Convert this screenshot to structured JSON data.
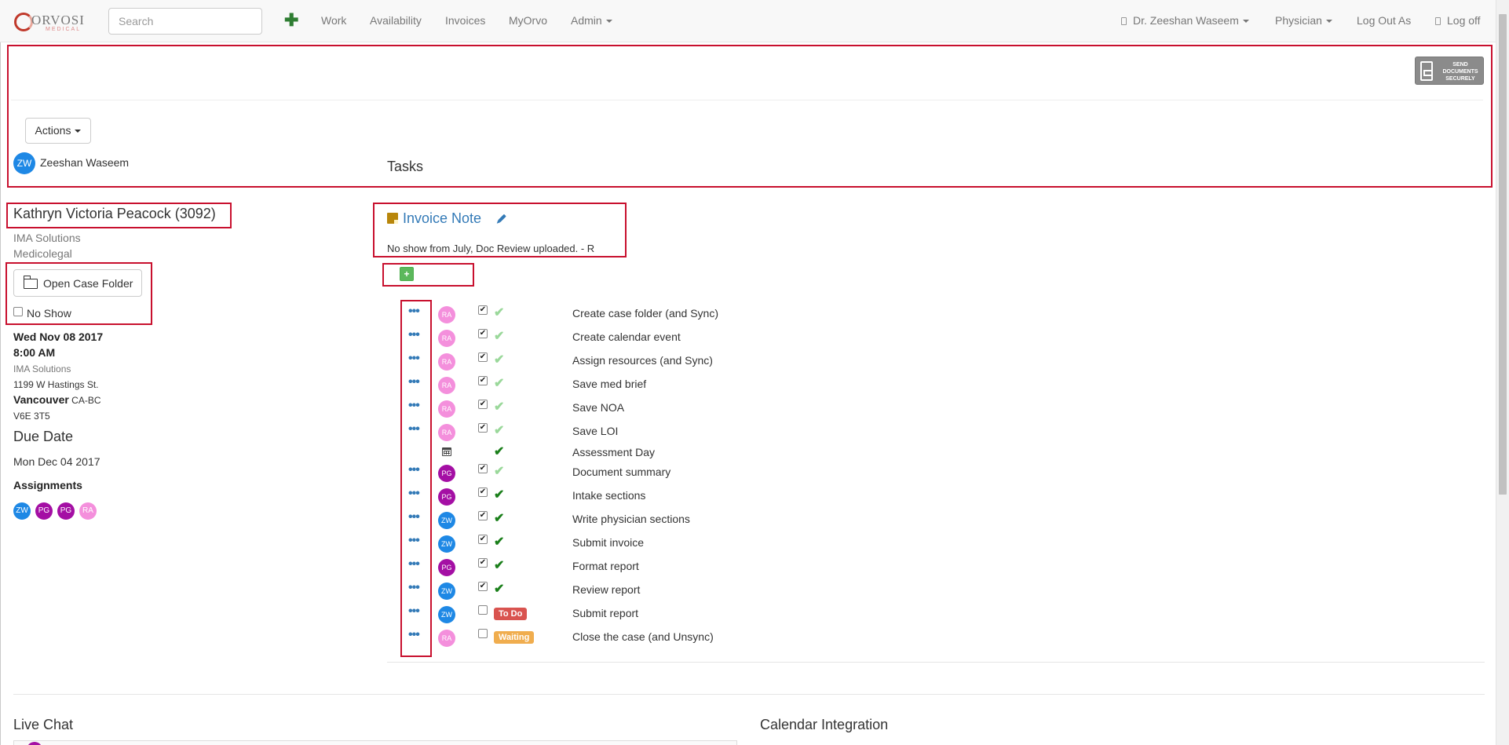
{
  "navbar": {
    "logo_text": "ORVOSI",
    "logo_sub": "MEDICAL",
    "search_placeholder": "Search",
    "add_icon": "plus-icon",
    "links": [
      "Work",
      "Availability",
      "Invoices",
      "MyOrvo",
      "Admin"
    ],
    "user": "Dr. Zeeshan Waseem",
    "role": "Physician",
    "logout_as": "Log Out As",
    "logoff": "Log off"
  },
  "header": {
    "send_docs_line1": "SEND",
    "send_docs_line2": "DOCUMENTS",
    "send_docs_line3": "SECURELY",
    "actions_label": "Actions",
    "user_initials": "ZW",
    "user_name": "Zeeshan Waseem",
    "tasks_title": "Tasks"
  },
  "case": {
    "patient_name": "Kathryn Victoria Peacock (3092)",
    "company": "IMA Solutions",
    "service": "Medicolegal",
    "open_folder_label": "Open Case Folder",
    "no_show_label": "No Show",
    "appt_date": "Wed Nov 08 2017",
    "appt_time": "8:00 AM",
    "location_name": "IMA Solutions",
    "address": "1199 W Hastings St.",
    "city": "Vancouver",
    "region": "CA-BC",
    "postal": "V6E 3T5",
    "due_title": "Due Date",
    "due_date": "Mon Dec 04 2017",
    "assignments_title": "Assignments",
    "assignees": [
      {
        "initials": "ZW",
        "color": "#1e88e5"
      },
      {
        "initials": "PG",
        "color": "#a40fa4"
      },
      {
        "initials": "PG",
        "color": "#a40fa4"
      },
      {
        "initials": "RA",
        "color": "#f48fdc"
      }
    ]
  },
  "invoice_note": {
    "title": "Invoice Note",
    "text": "No show from July, Doc Review uploaded. - R",
    "add_button": "+"
  },
  "tasks": [
    {
      "initials": "RA",
      "color": "#f48fdc",
      "kind": "check",
      "checked": true,
      "status": "done-light",
      "label": "Create case folder (and Sync)"
    },
    {
      "initials": "RA",
      "color": "#f48fdc",
      "kind": "check",
      "checked": true,
      "status": "done-light",
      "label": "Create calendar event"
    },
    {
      "initials": "RA",
      "color": "#f48fdc",
      "kind": "check",
      "checked": true,
      "status": "done-light",
      "label": "Assign resources (and Sync)"
    },
    {
      "initials": "RA",
      "color": "#f48fdc",
      "kind": "check",
      "checked": true,
      "status": "done-light",
      "label": "Save med brief"
    },
    {
      "initials": "RA",
      "color": "#f48fdc",
      "kind": "check",
      "checked": true,
      "status": "done-light",
      "label": "Save NOA"
    },
    {
      "initials": "RA",
      "color": "#f48fdc",
      "kind": "check",
      "checked": true,
      "status": "done-light",
      "label": "Save LOI"
    },
    {
      "initials": "",
      "color": "",
      "kind": "calendar",
      "checked": false,
      "status": "done-dark",
      "label": "Assessment Day"
    },
    {
      "initials": "PG",
      "color": "#a40fa4",
      "kind": "check",
      "checked": true,
      "status": "done-light",
      "label": "Document summary"
    },
    {
      "initials": "PG",
      "color": "#a40fa4",
      "kind": "check",
      "checked": true,
      "status": "done-dark",
      "label": "Intake sections"
    },
    {
      "initials": "ZW",
      "color": "#1e88e5",
      "kind": "check",
      "checked": true,
      "status": "done-dark",
      "label": "Write physician sections"
    },
    {
      "initials": "ZW",
      "color": "#1e88e5",
      "kind": "check",
      "checked": true,
      "status": "done-dark",
      "label": "Submit invoice"
    },
    {
      "initials": "PG",
      "color": "#a40fa4",
      "kind": "check",
      "checked": true,
      "status": "done-dark",
      "label": "Format report"
    },
    {
      "initials": "ZW",
      "color": "#1e88e5",
      "kind": "check",
      "checked": true,
      "status": "done-dark",
      "label": "Review report"
    },
    {
      "initials": "ZW",
      "color": "#1e88e5",
      "kind": "check",
      "checked": false,
      "status": "To Do",
      "label": "Submit report"
    },
    {
      "initials": "RA",
      "color": "#f48fdc",
      "kind": "check",
      "checked": false,
      "status": "Waiting",
      "label": "Close the case (and Unsync)"
    }
  ],
  "footer": {
    "live_chat": "Live Chat",
    "calendar_integration": "Calendar Integration"
  }
}
